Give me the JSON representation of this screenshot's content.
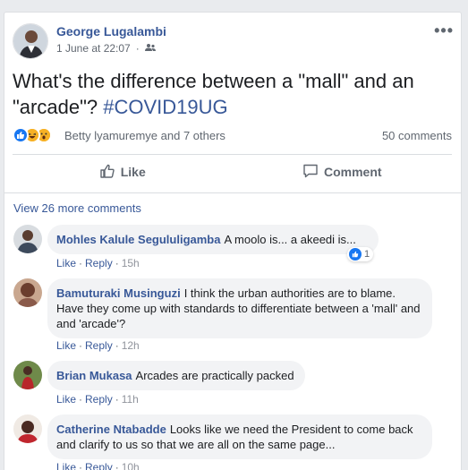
{
  "post": {
    "author": "George Lugalambi",
    "date": "1 June at 22:07",
    "audience_icon": "friends-icon",
    "text_main": "What's the difference between a \"mall\" and an \"arcade\"? ",
    "hashtag": "#COVID19UG",
    "reaction_names": "Betty lyamuremye and 7 others",
    "comments_count": "50 comments",
    "like_label": "Like",
    "comment_label": "Comment"
  },
  "comments_section": {
    "view_more": "View 26 more comments",
    "items": [
      {
        "author": "Mohles Kalule Segululigamba",
        "text": "A moolo is... a akeedi is...",
        "like": "Like",
        "reply": "Reply",
        "time": "15h",
        "reaction_count": "1"
      },
      {
        "author": "Bamuturaki Musinguzi",
        "text": "I think the urban authorities are to blame. Have they come up with standards to differentiate between a 'mall' and and 'arcade'?",
        "like": "Like",
        "reply": "Reply",
        "time": "12h"
      },
      {
        "author": "Brian Mukasa",
        "text": "Arcades are practically packed",
        "like": "Like",
        "reply": "Reply",
        "time": "11h"
      },
      {
        "author": "Catherine Ntabadde",
        "text": "Looks like we need the President to come back and clarify to us so that we are all on the same page...",
        "like": "Like",
        "reply": "Reply",
        "time": "10h"
      }
    ]
  },
  "colors": {
    "link_blue": "#385898",
    "like_blue": "#1877f2",
    "bubble_gray": "#f2f3f5"
  }
}
